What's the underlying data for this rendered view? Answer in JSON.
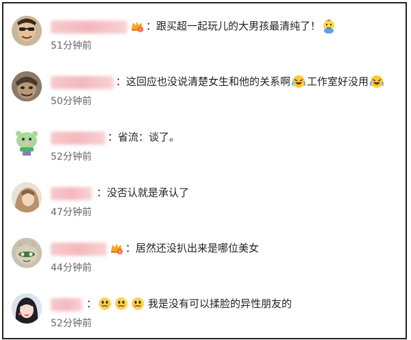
{
  "comments": [
    {
      "time": "51分钟前",
      "sep": "：",
      "parts": [
        {
          "type": "text",
          "value": "跟买超一起玩儿的大男孩最清纯了！"
        },
        {
          "type": "emoji",
          "icon": "baby-emoji-icon"
        }
      ]
    },
    {
      "time": "50分钟前",
      "sep": "：",
      "parts": [
        {
          "type": "text",
          "value": "这回应也没说清楚女生和他的关系啊"
        },
        {
          "type": "emoji",
          "icon": "laugh-cry-emoji-icon"
        },
        {
          "type": "text",
          "value": "工作室好没用"
        },
        {
          "type": "emoji",
          "icon": "laugh-cry-emoji-icon"
        }
      ]
    },
    {
      "time": "52分钟前",
      "sep": "：",
      "parts": [
        {
          "type": "text",
          "value": "省流：谈了。"
        }
      ]
    },
    {
      "time": "47分钟前",
      "sep": "：",
      "parts": [
        {
          "type": "text",
          "value": "没否认就是承认了"
        }
      ]
    },
    {
      "time": "44分钟前",
      "sep": "：",
      "parts": [
        {
          "type": "text",
          "value": "居然还没扒出来是哪位美女"
        }
      ]
    },
    {
      "time": "52分钟前",
      "sep": "：",
      "parts": [
        {
          "type": "emoji",
          "icon": "thinking-emoji-icon"
        },
        {
          "type": "emoji",
          "icon": "thinking-emoji-icon"
        },
        {
          "type": "emoji",
          "icon": "thinking-emoji-icon"
        },
        {
          "type": "text",
          "value": "我是没有可以揉脸的异性朋友的"
        }
      ]
    }
  ],
  "colors": {
    "text": "#222222",
    "time": "#666666",
    "name_blur": "#f4b8bd",
    "border": "#222222"
  }
}
